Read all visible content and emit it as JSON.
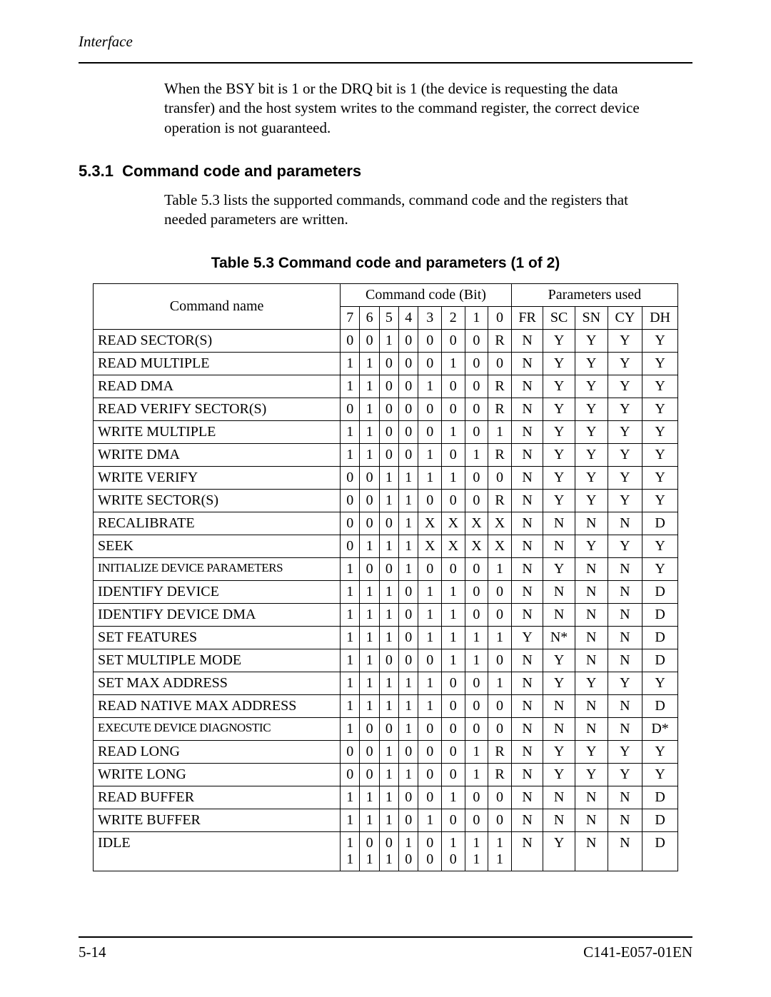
{
  "header": {
    "section": "Interface"
  },
  "para1": "When the BSY bit is 1 or the DRQ bit is 1 (the device is requesting the data transfer) and the host system writes to the command register, the correct device operation is not guaranteed.",
  "section": {
    "num": "5.3.1",
    "title": "Command code and parameters"
  },
  "para2": "Table 5.3 lists the supported commands, command code and the registers that needed parameters are written.",
  "table": {
    "caption": "Table 5.3   Command code and parameters (1 of 2)",
    "head": {
      "name": "Command name",
      "codetitle": "Command code (Bit)",
      "paramtitle": "Parameters used",
      "bits": [
        "7",
        "6",
        "5",
        "4",
        "3",
        "2",
        "1",
        "0"
      ],
      "params": [
        "FR",
        "SC",
        "SN",
        "CY",
        "DH"
      ]
    },
    "rows": [
      {
        "name": "READ SECTOR(S)",
        "b": [
          "0",
          "0",
          "1",
          "0",
          "0",
          "0",
          "0",
          "R"
        ],
        "p": [
          "N",
          "Y",
          "Y",
          "Y",
          "Y"
        ]
      },
      {
        "name": "READ MULTIPLE",
        "b": [
          "1",
          "1",
          "0",
          "0",
          "0",
          "1",
          "0",
          "0"
        ],
        "p": [
          "N",
          "Y",
          "Y",
          "Y",
          "Y"
        ]
      },
      {
        "name": "READ DMA",
        "b": [
          "1",
          "1",
          "0",
          "0",
          "1",
          "0",
          "0",
          "R"
        ],
        "p": [
          "N",
          "Y",
          "Y",
          "Y",
          "Y"
        ]
      },
      {
        "name": "READ VERIFY SECTOR(S)",
        "b": [
          "0",
          "1",
          "0",
          "0",
          "0",
          "0",
          "0",
          "R"
        ],
        "p": [
          "N",
          "Y",
          "Y",
          "Y",
          "Y"
        ]
      },
      {
        "name": "WRITE MULTIPLE",
        "b": [
          "1",
          "1",
          "0",
          "0",
          "0",
          "1",
          "0",
          "1"
        ],
        "p": [
          "N",
          "Y",
          "Y",
          "Y",
          "Y"
        ]
      },
      {
        "name": "WRITE DMA",
        "b": [
          "1",
          "1",
          "0",
          "0",
          "1",
          "0",
          "1",
          "R"
        ],
        "p": [
          "N",
          "Y",
          "Y",
          "Y",
          "Y"
        ]
      },
      {
        "name": "WRITE VERIFY",
        "b": [
          "0",
          "0",
          "1",
          "1",
          "1",
          "1",
          "0",
          "0"
        ],
        "p": [
          "N",
          "Y",
          "Y",
          "Y",
          "Y"
        ]
      },
      {
        "name": "WRITE SECTOR(S)",
        "b": [
          "0",
          "0",
          "1",
          "1",
          "0",
          "0",
          "0",
          "R"
        ],
        "p": [
          "N",
          "Y",
          "Y",
          "Y",
          "Y"
        ]
      },
      {
        "name": "RECALIBRATE",
        "b": [
          "0",
          "0",
          "0",
          "1",
          "X",
          "X",
          "X",
          "X"
        ],
        "p": [
          "N",
          "N",
          "N",
          "N",
          "D"
        ]
      },
      {
        "name": "SEEK",
        "b": [
          "0",
          "1",
          "1",
          "1",
          "X",
          "X",
          "X",
          "X"
        ],
        "p": [
          "N",
          "N",
          "Y",
          "Y",
          "Y"
        ]
      },
      {
        "name": "INITIALIZE DEVICE PARAMETERS",
        "small": true,
        "b": [
          "1",
          "0",
          "0",
          "1",
          "0",
          "0",
          "0",
          "1"
        ],
        "p": [
          "N",
          "Y",
          "N",
          "N",
          "Y"
        ]
      },
      {
        "name": "IDENTIFY DEVICE",
        "b": [
          "1",
          "1",
          "1",
          "0",
          "1",
          "1",
          "0",
          "0"
        ],
        "p": [
          "N",
          "N",
          "N",
          "N",
          "D"
        ]
      },
      {
        "name": "IDENTIFY DEVICE DMA",
        "b": [
          "1",
          "1",
          "1",
          "0",
          "1",
          "1",
          "0",
          "0"
        ],
        "p": [
          "N",
          "N",
          "N",
          "N",
          "D"
        ]
      },
      {
        "name": "SET FEATURES",
        "b": [
          "1",
          "1",
          "1",
          "0",
          "1",
          "1",
          "1",
          "1"
        ],
        "p": [
          "Y",
          "N*",
          "N",
          "N",
          "D"
        ]
      },
      {
        "name": "SET MULTIPLE MODE",
        "b": [
          "1",
          "1",
          "0",
          "0",
          "0",
          "1",
          "1",
          "0"
        ],
        "p": [
          "N",
          "Y",
          "N",
          "N",
          "D"
        ]
      },
      {
        "name": "SET MAX ADDRESS",
        "b": [
          "1",
          "1",
          "1",
          "1",
          "1",
          "0",
          "0",
          "1"
        ],
        "p": [
          "N",
          "Y",
          "Y",
          "Y",
          "Y"
        ]
      },
      {
        "name": "READ NATIVE MAX ADDRESS",
        "b": [
          "1",
          "1",
          "1",
          "1",
          "1",
          "0",
          "0",
          "0"
        ],
        "p": [
          "N",
          "N",
          "N",
          "N",
          "D"
        ]
      },
      {
        "name": "EXECUTE DEVICE DIAGNOSTIC",
        "small": true,
        "b": [
          "1",
          "0",
          "0",
          "1",
          "0",
          "0",
          "0",
          "0"
        ],
        "p": [
          "N",
          "N",
          "N",
          "N",
          "D*"
        ]
      },
      {
        "name": "READ LONG",
        "b": [
          "0",
          "0",
          "1",
          "0",
          "0",
          "0",
          "1",
          "R"
        ],
        "p": [
          "N",
          "Y",
          "Y",
          "Y",
          "Y"
        ]
      },
      {
        "name": "WRITE LONG",
        "b": [
          "0",
          "0",
          "1",
          "1",
          "0",
          "0",
          "1",
          "R"
        ],
        "p": [
          "N",
          "Y",
          "Y",
          "Y",
          "Y"
        ]
      },
      {
        "name": "READ BUFFER",
        "b": [
          "1",
          "1",
          "1",
          "0",
          "0",
          "1",
          "0",
          "0"
        ],
        "p": [
          "N",
          "N",
          "N",
          "N",
          "D"
        ]
      },
      {
        "name": "WRITE BUFFER",
        "b": [
          "1",
          "1",
          "1",
          "0",
          "1",
          "0",
          "0",
          "0"
        ],
        "p": [
          "N",
          "N",
          "N",
          "N",
          "D"
        ]
      },
      {
        "name": "IDLE",
        "b": [
          "1\n1",
          "0\n1",
          "0\n1",
          "1\n0",
          "0\n0",
          "1\n0",
          "1\n1",
          "1\n1"
        ],
        "p": [
          "N",
          "Y",
          "N",
          "N",
          "D"
        ]
      }
    ]
  },
  "footer": {
    "left": "5-14",
    "right": "C141-E057-01EN"
  }
}
